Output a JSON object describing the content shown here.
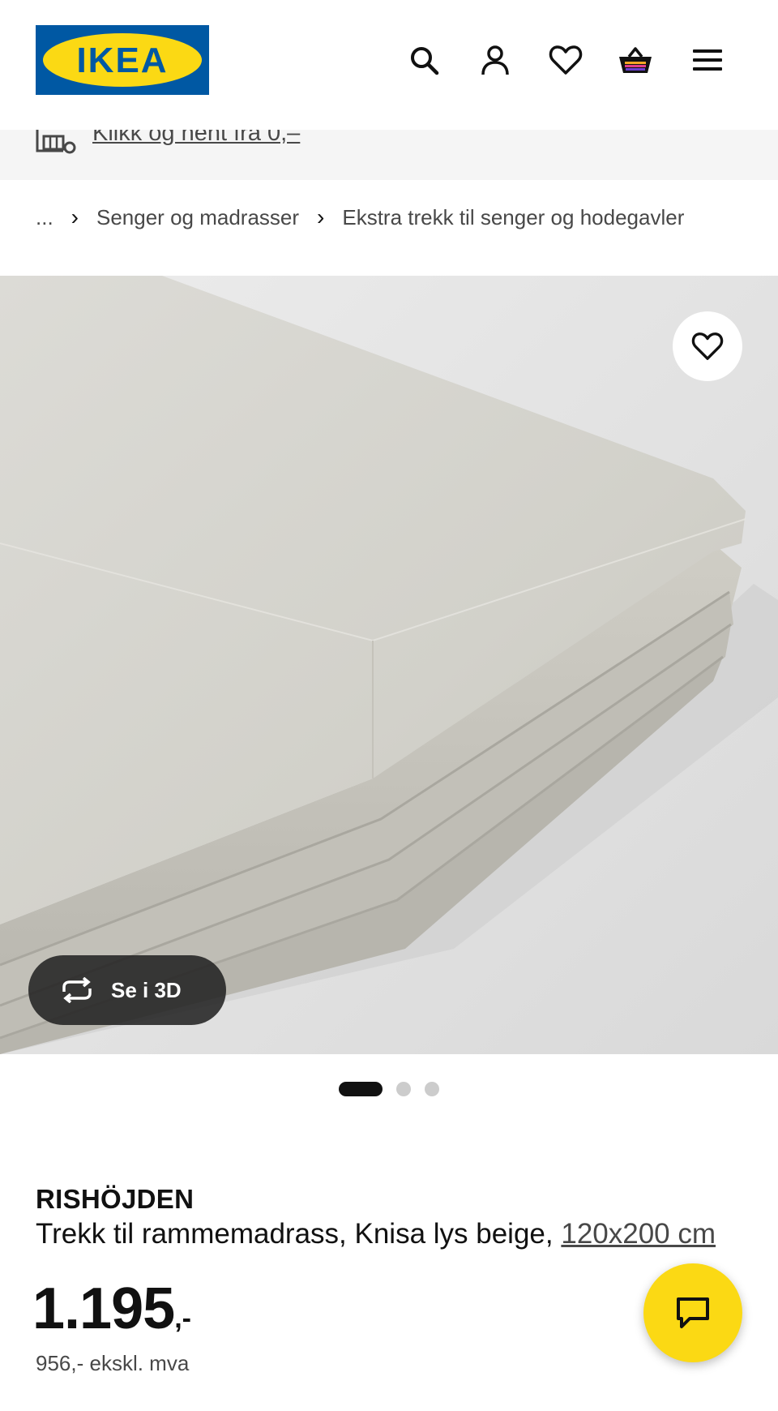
{
  "header": {
    "logo_text": "IKEA",
    "icons": [
      "search-icon",
      "user-icon",
      "heart-icon",
      "basket-icon",
      "menu-icon"
    ],
    "brand_colors": {
      "blue": "#0058a3",
      "yellow": "#fbd914"
    }
  },
  "promo": {
    "icon": "truck-store-icon",
    "link_text": "Klikk og hent fra 0,–"
  },
  "breadcrumb": {
    "ellipsis": "...",
    "items": [
      "Senger og madrasser",
      "Ekstra trekk til senger og hodegavler"
    ],
    "separator": "›"
  },
  "gallery": {
    "image": "folded-light-beige-mattress-cover",
    "view_3d_label": "Se i 3D",
    "slide_count": 3,
    "active_slide": 1
  },
  "product": {
    "name": "RISHÖJDEN",
    "description": "Trekk til rammemadrass, Knisa lys beige,",
    "size_link": "120x200 cm",
    "price_integer": "1.195",
    "price_suffix": ",-",
    "price_ex_vat": "956,- ekskl. mva"
  },
  "chat": {
    "icon": "chat-icon"
  }
}
